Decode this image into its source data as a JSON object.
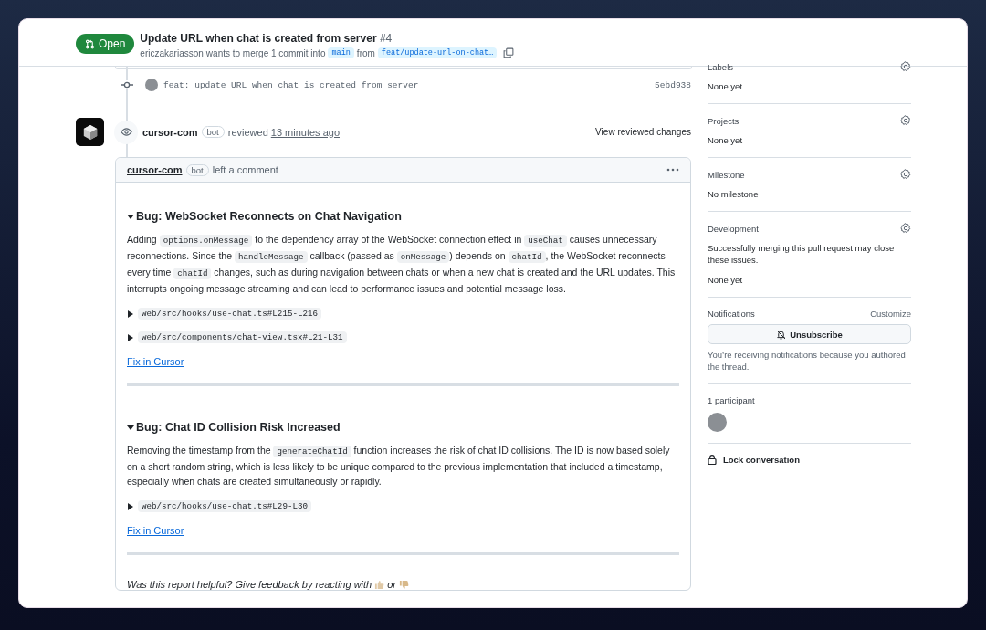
{
  "header": {
    "status": "Open",
    "title": "Update URL when chat is created from server",
    "number": "#4",
    "author": "ericzakariasson",
    "merge_text": "wants to merge 1 commit into",
    "base_branch": "main",
    "from_text": "from",
    "head_branch": "feat/update-url-on-chat…"
  },
  "commit": {
    "message": "feat: update URL when chat is created from server",
    "sha": "5ebd938"
  },
  "review": {
    "author": "cursor-com",
    "badge": "bot",
    "action": "reviewed",
    "time": "13 minutes ago",
    "link": "View reviewed changes"
  },
  "comment": {
    "author": "cursor-com",
    "badge": "bot",
    "action": "left a comment",
    "bugs": [
      {
        "title": "Bug: WebSocket Reconnects on Chat Navigation",
        "expanded": true,
        "body": [
          {
            "kind": "text",
            "text": "Adding "
          },
          {
            "kind": "code",
            "text": "options.onMessage"
          },
          {
            "kind": "text",
            "text": " to the dependency array of the WebSocket connection effect in "
          },
          {
            "kind": "code",
            "text": "useChat"
          },
          {
            "kind": "text",
            "text": " causes unnecessary reconnections. Since the "
          },
          {
            "kind": "code",
            "text": "handleMessage"
          },
          {
            "kind": "text",
            "text": " callback (passed as "
          },
          {
            "kind": "code",
            "text": "onMessage"
          },
          {
            "kind": "text",
            "text": ") depends on "
          },
          {
            "kind": "code",
            "text": "chatId"
          },
          {
            "kind": "text",
            "text": ", the WebSocket reconnects every time "
          },
          {
            "kind": "code",
            "text": "chatId"
          },
          {
            "kind": "text",
            "text": " changes, such as during navigation between chats or when a new chat is created and the URL updates. This interrupts ongoing message streaming and can lead to performance issues and potential message loss."
          }
        ],
        "files": [
          {
            "path": "web/src/hooks/use-chat.ts#L215-L216",
            "expanded": false
          },
          {
            "path": "web/src/components/chat-view.tsx#L21-L31",
            "expanded": false
          }
        ],
        "fix_link": "Fix in Cursor"
      },
      {
        "title": "Bug: Chat ID Collision Risk Increased",
        "expanded": true,
        "body": [
          {
            "kind": "text",
            "text": "Removing the timestamp from the "
          },
          {
            "kind": "code",
            "text": "generateChatId"
          },
          {
            "kind": "text",
            "text": " function increases the risk of chat ID collisions. The ID is now based solely on a short random string, which is less likely to be unique compared to the previous implementation that included a timestamp, especially when chats are created simultaneously or rapidly."
          }
        ],
        "files": [
          {
            "path": "web/src/hooks/use-chat.ts#L29-L30",
            "expanded": false
          }
        ],
        "fix_link": "Fix in Cursor"
      }
    ],
    "feedback": {
      "text": "Was this report helpful? Give feedback by reacting with",
      "or": "or"
    }
  },
  "sidebar": {
    "labels": {
      "title": "Labels",
      "value": "None yet"
    },
    "projects": {
      "title": "Projects",
      "value": "None yet"
    },
    "milestone": {
      "title": "Milestone",
      "value": "No milestone"
    },
    "development": {
      "title": "Development",
      "description": "Successfully merging this pull request may close these issues.",
      "value": "None yet"
    },
    "notifications": {
      "title": "Notifications",
      "customize": "Customize",
      "button": "Unsubscribe",
      "note": "You’re receiving notifications because you authored the thread."
    },
    "participants": {
      "title": "1 participant"
    },
    "lock": {
      "label": "Lock conversation"
    }
  }
}
